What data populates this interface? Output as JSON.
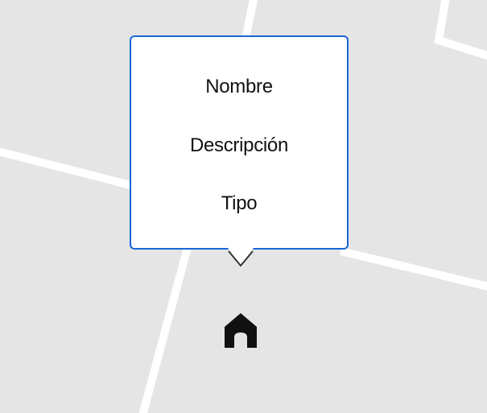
{
  "map": {
    "background_color": "#e5e5e5",
    "road_color": "#ffffff"
  },
  "popup": {
    "border_color": "#1a66d6",
    "fields": {
      "nombre": "Nombre",
      "descripcion": "Descripción",
      "tipo": "Tipo"
    }
  },
  "marker": {
    "icon": "home-icon",
    "color": "#111111"
  }
}
